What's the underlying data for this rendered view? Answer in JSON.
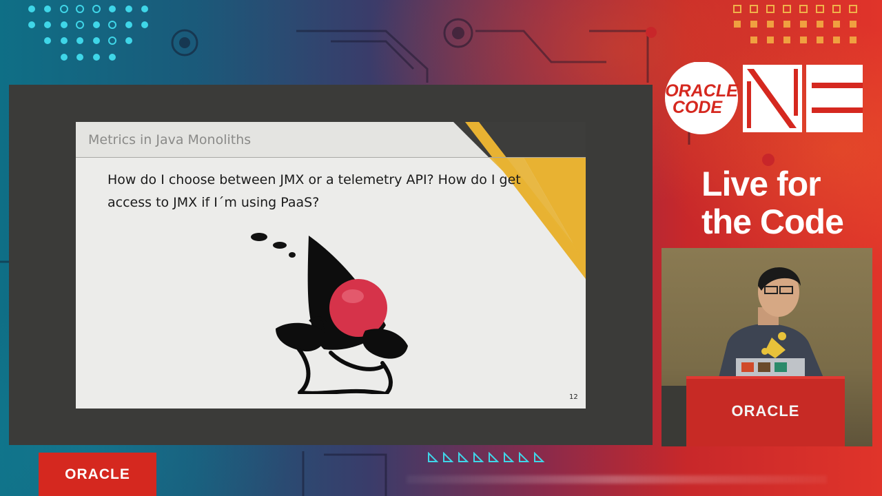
{
  "slide": {
    "title": "Metrics in Java Monoliths",
    "body_line1": "How do I choose between JMX or a telemetry API? How do I get",
    "body_line2": "access to JMX if I´m using PaaS?",
    "page_number": "12",
    "mascot": "java-duke-mascot"
  },
  "brand": {
    "logo_line1": "ORACLE",
    "logo_line2": "CODE",
    "tagline_line1": "Live for",
    "tagline_line2": "the Code"
  },
  "camera": {
    "podium_label": "ORACLE"
  },
  "footer": {
    "oracle_label": "ORACLE"
  },
  "colors": {
    "oracle_red": "#d5281f",
    "slide_accent_yellow": "#e8b232",
    "slide_accent_dark": "#3d3d3b",
    "duke_nose": "#d6334a"
  }
}
